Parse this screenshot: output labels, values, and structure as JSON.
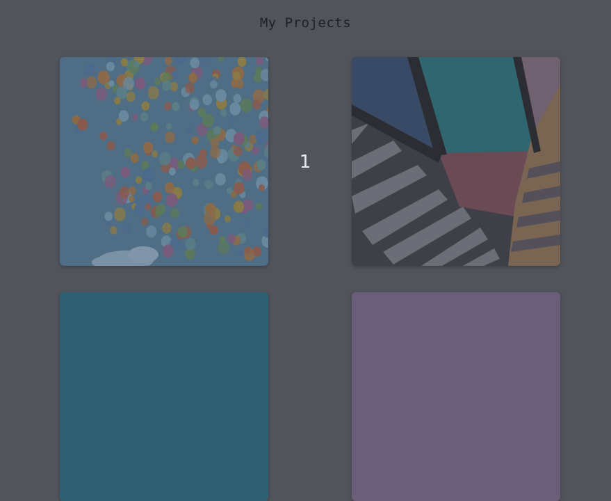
{
  "page": {
    "title": "My Projects",
    "slide_number": "1"
  },
  "colors": {
    "background": "#52545c",
    "title_text": "#1e2026",
    "slide_number": "#e9eaee"
  },
  "cards": [
    {
      "image": "balloons-in-sky",
      "sky_color": "#4f6d84"
    },
    {
      "image": "colorful-geometric-mural",
      "base_color": "#3f4047"
    },
    {
      "image": "teal-image",
      "base_color": "#2e5f72"
    },
    {
      "image": "purple-image",
      "base_color": "#6a5f78"
    }
  ]
}
